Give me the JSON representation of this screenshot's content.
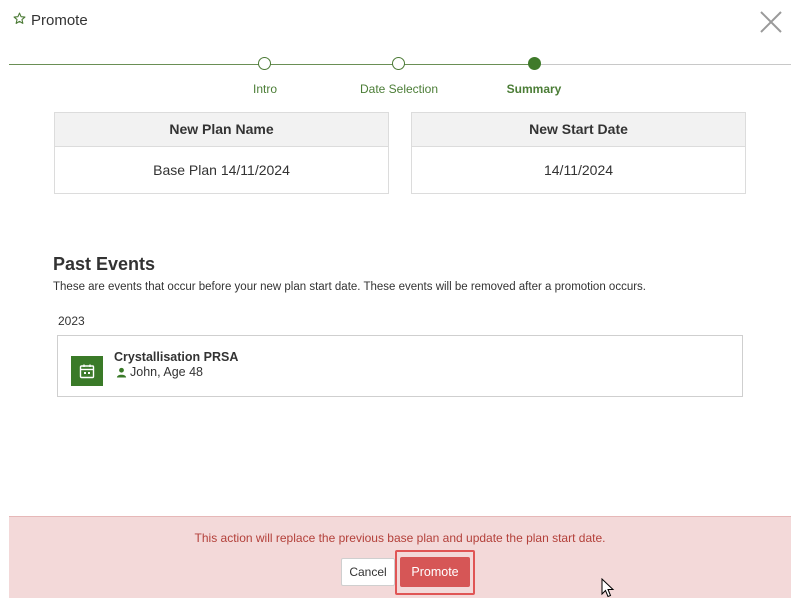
{
  "header": {
    "title": "Promote",
    "icon": "star-outline-icon",
    "close_icon": "close-icon"
  },
  "stepper": {
    "steps": [
      {
        "label": "Intro",
        "state": "completed"
      },
      {
        "label": "Date Selection",
        "state": "completed"
      },
      {
        "label": "Summary",
        "state": "active"
      }
    ],
    "colors": {
      "accent": "#3f7a2a",
      "label": "#4b7d36"
    }
  },
  "summary": {
    "plan_name": {
      "header": "New Plan Name",
      "value": "Base Plan 14/11/2024"
    },
    "start_date": {
      "header": "New Start Date",
      "value": "14/11/2024"
    }
  },
  "past_events": {
    "title": "Past Events",
    "description": "These are events that occur before your new plan start date. These events will be removed after a promotion occurs.",
    "groups": [
      {
        "year": "2023",
        "events": [
          {
            "title": "Crystallisation PRSA",
            "person": "John, Age 48",
            "icon": "calendar-icon",
            "icon_color": "#3a7a28"
          }
        ]
      }
    ]
  },
  "footer": {
    "message": "This action will replace the previous base plan and update the plan start date.",
    "cancel_label": "Cancel",
    "promote_label": "Promote",
    "colors": {
      "background": "#f3d9d9",
      "message": "#b3403a",
      "primary": "#d65656"
    }
  }
}
